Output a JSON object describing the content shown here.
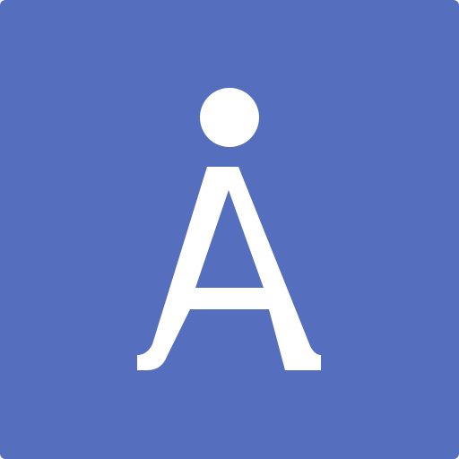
{
  "icon": {
    "name": "letter-a-with-dot-logo",
    "text": "A",
    "colors": {
      "background": "#566EBE",
      "foreground": "#FFFFFF"
    }
  }
}
